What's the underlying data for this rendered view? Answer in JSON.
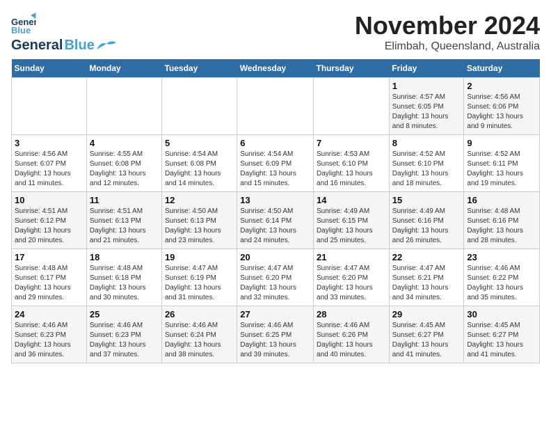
{
  "logo": {
    "line1": "General",
    "line2": "Blue"
  },
  "title": "November 2024",
  "location": "Elimbah, Queensland, Australia",
  "days_header": [
    "Sunday",
    "Monday",
    "Tuesday",
    "Wednesday",
    "Thursday",
    "Friday",
    "Saturday"
  ],
  "weeks": [
    [
      {
        "day": "",
        "info": ""
      },
      {
        "day": "",
        "info": ""
      },
      {
        "day": "",
        "info": ""
      },
      {
        "day": "",
        "info": ""
      },
      {
        "day": "",
        "info": ""
      },
      {
        "day": "1",
        "info": "Sunrise: 4:57 AM\nSunset: 6:05 PM\nDaylight: 13 hours\nand 8 minutes."
      },
      {
        "day": "2",
        "info": "Sunrise: 4:56 AM\nSunset: 6:06 PM\nDaylight: 13 hours\nand 9 minutes."
      }
    ],
    [
      {
        "day": "3",
        "info": "Sunrise: 4:56 AM\nSunset: 6:07 PM\nDaylight: 13 hours\nand 11 minutes."
      },
      {
        "day": "4",
        "info": "Sunrise: 4:55 AM\nSunset: 6:08 PM\nDaylight: 13 hours\nand 12 minutes."
      },
      {
        "day": "5",
        "info": "Sunrise: 4:54 AM\nSunset: 6:08 PM\nDaylight: 13 hours\nand 14 minutes."
      },
      {
        "day": "6",
        "info": "Sunrise: 4:54 AM\nSunset: 6:09 PM\nDaylight: 13 hours\nand 15 minutes."
      },
      {
        "day": "7",
        "info": "Sunrise: 4:53 AM\nSunset: 6:10 PM\nDaylight: 13 hours\nand 16 minutes."
      },
      {
        "day": "8",
        "info": "Sunrise: 4:52 AM\nSunset: 6:10 PM\nDaylight: 13 hours\nand 18 minutes."
      },
      {
        "day": "9",
        "info": "Sunrise: 4:52 AM\nSunset: 6:11 PM\nDaylight: 13 hours\nand 19 minutes."
      }
    ],
    [
      {
        "day": "10",
        "info": "Sunrise: 4:51 AM\nSunset: 6:12 PM\nDaylight: 13 hours\nand 20 minutes."
      },
      {
        "day": "11",
        "info": "Sunrise: 4:51 AM\nSunset: 6:13 PM\nDaylight: 13 hours\nand 21 minutes."
      },
      {
        "day": "12",
        "info": "Sunrise: 4:50 AM\nSunset: 6:13 PM\nDaylight: 13 hours\nand 23 minutes."
      },
      {
        "day": "13",
        "info": "Sunrise: 4:50 AM\nSunset: 6:14 PM\nDaylight: 13 hours\nand 24 minutes."
      },
      {
        "day": "14",
        "info": "Sunrise: 4:49 AM\nSunset: 6:15 PM\nDaylight: 13 hours\nand 25 minutes."
      },
      {
        "day": "15",
        "info": "Sunrise: 4:49 AM\nSunset: 6:16 PM\nDaylight: 13 hours\nand 26 minutes."
      },
      {
        "day": "16",
        "info": "Sunrise: 4:48 AM\nSunset: 6:16 PM\nDaylight: 13 hours\nand 28 minutes."
      }
    ],
    [
      {
        "day": "17",
        "info": "Sunrise: 4:48 AM\nSunset: 6:17 PM\nDaylight: 13 hours\nand 29 minutes."
      },
      {
        "day": "18",
        "info": "Sunrise: 4:48 AM\nSunset: 6:18 PM\nDaylight: 13 hours\nand 30 minutes."
      },
      {
        "day": "19",
        "info": "Sunrise: 4:47 AM\nSunset: 6:19 PM\nDaylight: 13 hours\nand 31 minutes."
      },
      {
        "day": "20",
        "info": "Sunrise: 4:47 AM\nSunset: 6:20 PM\nDaylight: 13 hours\nand 32 minutes."
      },
      {
        "day": "21",
        "info": "Sunrise: 4:47 AM\nSunset: 6:20 PM\nDaylight: 13 hours\nand 33 minutes."
      },
      {
        "day": "22",
        "info": "Sunrise: 4:47 AM\nSunset: 6:21 PM\nDaylight: 13 hours\nand 34 minutes."
      },
      {
        "day": "23",
        "info": "Sunrise: 4:46 AM\nSunset: 6:22 PM\nDaylight: 13 hours\nand 35 minutes."
      }
    ],
    [
      {
        "day": "24",
        "info": "Sunrise: 4:46 AM\nSunset: 6:23 PM\nDaylight: 13 hours\nand 36 minutes."
      },
      {
        "day": "25",
        "info": "Sunrise: 4:46 AM\nSunset: 6:23 PM\nDaylight: 13 hours\nand 37 minutes."
      },
      {
        "day": "26",
        "info": "Sunrise: 4:46 AM\nSunset: 6:24 PM\nDaylight: 13 hours\nand 38 minutes."
      },
      {
        "day": "27",
        "info": "Sunrise: 4:46 AM\nSunset: 6:25 PM\nDaylight: 13 hours\nand 39 minutes."
      },
      {
        "day": "28",
        "info": "Sunrise: 4:46 AM\nSunset: 6:26 PM\nDaylight: 13 hours\nand 40 minutes."
      },
      {
        "day": "29",
        "info": "Sunrise: 4:45 AM\nSunset: 6:27 PM\nDaylight: 13 hours\nand 41 minutes."
      },
      {
        "day": "30",
        "info": "Sunrise: 4:45 AM\nSunset: 6:27 PM\nDaylight: 13 hours\nand 41 minutes."
      }
    ]
  ]
}
